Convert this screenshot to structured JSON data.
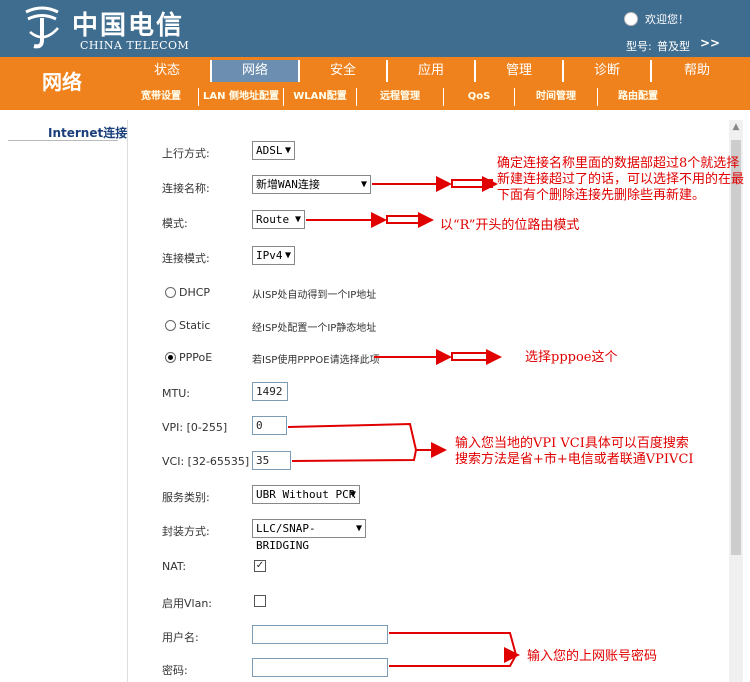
{
  "header": {
    "brand_cn": "中国电信",
    "brand_en": "CHINA TELECOM",
    "welcome": "欢迎您！",
    "model_label": "型号:",
    "model_value": "普及型",
    "more": ">>"
  },
  "nav": {
    "section": "网络",
    "tabs": [
      "状态",
      "网络",
      "安全",
      "应用",
      "管理",
      "诊断",
      "帮助"
    ],
    "active_tab": "网络",
    "subtabs": [
      "宽带设置",
      "LAN 侧地址配置",
      "WLAN配置",
      "远程管理",
      "QoS",
      "时间管理",
      "路由配置"
    ]
  },
  "sidebar": {
    "item": "Internet连接"
  },
  "form": {
    "uplink_label": "上行方式:",
    "uplink_value": "ADSL",
    "conn_name_label": "连接名称:",
    "conn_name_value": "新增WAN连接",
    "mode_label": "模式:",
    "mode_value": "Route",
    "conn_mode_label": "连接模式:",
    "conn_mode_value": "IPv4",
    "dhcp_label": "DHCP",
    "dhcp_desc": "从ISP处自动得到一个IP地址",
    "static_label": "Static",
    "static_desc": "经ISP处配置一个IP静态地址",
    "pppoe_label": "PPPoE",
    "pppoe_desc": "若ISP使用PPPOE请选择此项",
    "mtu_label": "MTU:",
    "mtu_value": "1492",
    "vpi_label": "VPI: [0-255]",
    "vpi_value": "0",
    "vci_label": "VCI: [32-65535]",
    "vci_value": "35",
    "service_label": "服务类别:",
    "service_value": "UBR Without PCR",
    "encap_label": "封装方式:",
    "encap_value": "LLC/SNAP-BRIDGING",
    "nat_label": "NAT:",
    "nat_checked": "✓",
    "vlan_label": "启用Vlan:",
    "username_label": "用户名:",
    "username_value": "",
    "password_label": "密码:",
    "password_value": ""
  },
  "annotations": {
    "note_name": "确定连接名称里面的数据部超过8个就选择新建连接超过了的话，可以选择不用的在最下面有个删除连接先删除些再新建。",
    "note_mode": "以“R”开头的位路由模式",
    "note_pppoe": "选择pppoe这个",
    "note_vpi_1": "输入您当地的VPI VCI具体可以百度搜索",
    "note_vpi_2": "搜索方法是省+市+电信或者联通VPIVCI",
    "note_account": "输入您的上网账号密码",
    "color": "#e00000"
  },
  "colors": {
    "header": "#3f6d8f",
    "nav": "#f0821e",
    "active_tab": "#6c8eb0"
  }
}
